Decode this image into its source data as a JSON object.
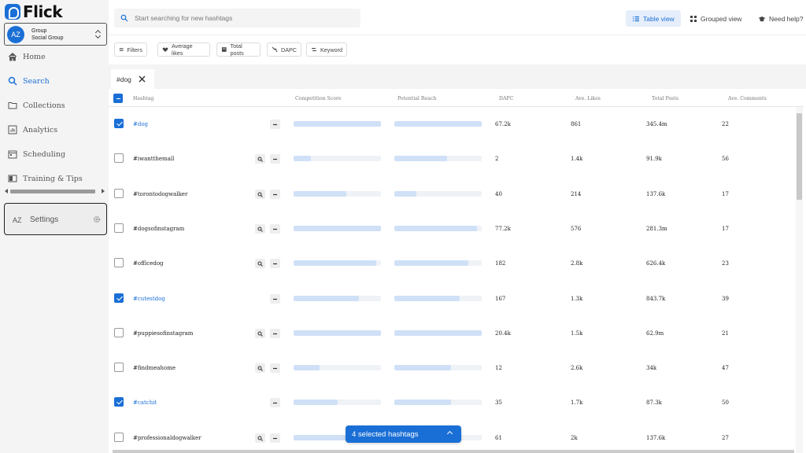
{
  "brand": {
    "name": "Flick",
    "color": "#1a6fd6"
  },
  "account": {
    "initials": "AZ",
    "line1": "Group",
    "line2": "Social Group"
  },
  "nav": [
    {
      "label": "Home",
      "icon": "home-icon",
      "active": false
    },
    {
      "label": "Search",
      "icon": "search-icon",
      "active": true
    },
    {
      "label": "Collections",
      "icon": "folder-icon",
      "active": false
    },
    {
      "label": "Analytics",
      "icon": "chart-icon",
      "active": false
    },
    {
      "label": "Scheduling",
      "icon": "calendar-icon",
      "active": false
    },
    {
      "label": "Training & Tips",
      "icon": "book-icon",
      "active": false
    }
  ],
  "settings": {
    "initials": "AZ",
    "label": "Settings"
  },
  "search": {
    "placeholder": "Start searching for new hashtags",
    "value": ""
  },
  "topbar": {
    "table_view": "Table view",
    "grouped_view": "Grouped view",
    "help": "Need help?"
  },
  "filters": [
    "Filters",
    "Average likes",
    "Total posts",
    "DAPC",
    "Keyword"
  ],
  "active_chip": "#dog",
  "columns": {
    "hashtag": "Hashtag",
    "competition": "Competition Score",
    "reach": "Potential Reach",
    "dapc": "DAPC",
    "likes": "Ave. Likes",
    "posts": "Total Posts",
    "comments": "Ave. Comments"
  },
  "rows": [
    {
      "hashtag": "#dog",
      "selected": true,
      "competition": 1.0,
      "reach": 1.0,
      "dapc": "67.2k",
      "likes": "861",
      "posts": "345.4m",
      "comments": "22"
    },
    {
      "hashtag": "#iwantthemall",
      "selected": false,
      "competition": 0.2,
      "reach": 0.6,
      "dapc": "2",
      "likes": "1.4k",
      "posts": "91.9k",
      "comments": "56"
    },
    {
      "hashtag": "#torontodogwalker",
      "selected": false,
      "competition": 0.6,
      "reach": 0.25,
      "dapc": "40",
      "likes": "214",
      "posts": "137.6k",
      "comments": "17"
    },
    {
      "hashtag": "#dogsofinstagram",
      "selected": false,
      "competition": 1.0,
      "reach": 0.95,
      "dapc": "77.2k",
      "likes": "576",
      "posts": "281.3m",
      "comments": "17"
    },
    {
      "hashtag": "#officedog",
      "selected": false,
      "competition": 0.95,
      "reach": 0.85,
      "dapc": "182",
      "likes": "2.8k",
      "posts": "626.4k",
      "comments": "23"
    },
    {
      "hashtag": "#cutestdog",
      "selected": true,
      "competition": 0.75,
      "reach": 0.75,
      "dapc": "167",
      "likes": "1.3k",
      "posts": "843.7k",
      "comments": "39"
    },
    {
      "hashtag": "#puppiesofinstagram",
      "selected": false,
      "competition": 1.0,
      "reach": 1.0,
      "dapc": "20.4k",
      "likes": "1.5k",
      "posts": "62.9m",
      "comments": "21"
    },
    {
      "hashtag": "#findmeahome",
      "selected": false,
      "competition": 0.3,
      "reach": 0.65,
      "dapc": "12",
      "likes": "2.6k",
      "posts": "34k",
      "comments": "47"
    },
    {
      "hashtag": "#catchit",
      "selected": true,
      "competition": 0.5,
      "reach": 0.65,
      "dapc": "35",
      "likes": "1.7k",
      "posts": "87.3k",
      "comments": "50"
    },
    {
      "hashtag": "#professionaldogwalker",
      "selected": false,
      "competition": 0.6,
      "reach": 0.3,
      "dapc": "61",
      "likes": "2k",
      "posts": "137.6k",
      "comments": "27"
    }
  ],
  "selection_pill": "4 selected hashtags"
}
